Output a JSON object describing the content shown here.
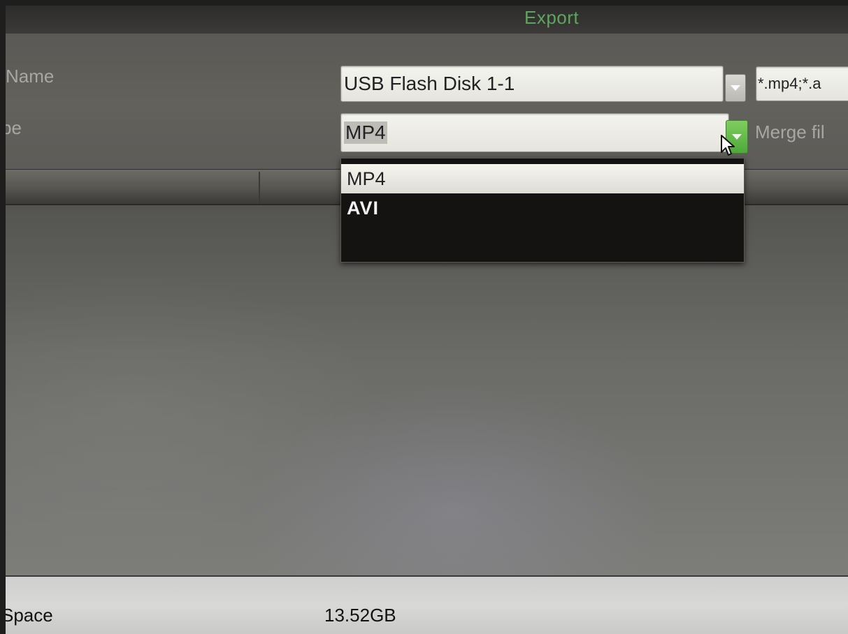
{
  "window": {
    "title": "Export"
  },
  "form": {
    "device_name_label": "Name",
    "device_name_value": "USB Flash Disk 1-1",
    "file_filter_value": "*.mp4;*.a",
    "file_type_label": "pe",
    "file_type_value": "MP4",
    "merge_label": "Merge fil"
  },
  "dropdown": {
    "options": [
      {
        "label": "MP4",
        "selected": true
      },
      {
        "label": "AVI",
        "selected": false
      }
    ]
  },
  "footer": {
    "free_space_label": "Space",
    "free_space_value": "13.52GB"
  },
  "colors": {
    "title_green": "#5fa55f",
    "arrow_green": "#4ea83a"
  },
  "icons": {
    "dropdown_arrow": "chevron-down-icon",
    "cursor": "mouse-pointer-icon"
  }
}
